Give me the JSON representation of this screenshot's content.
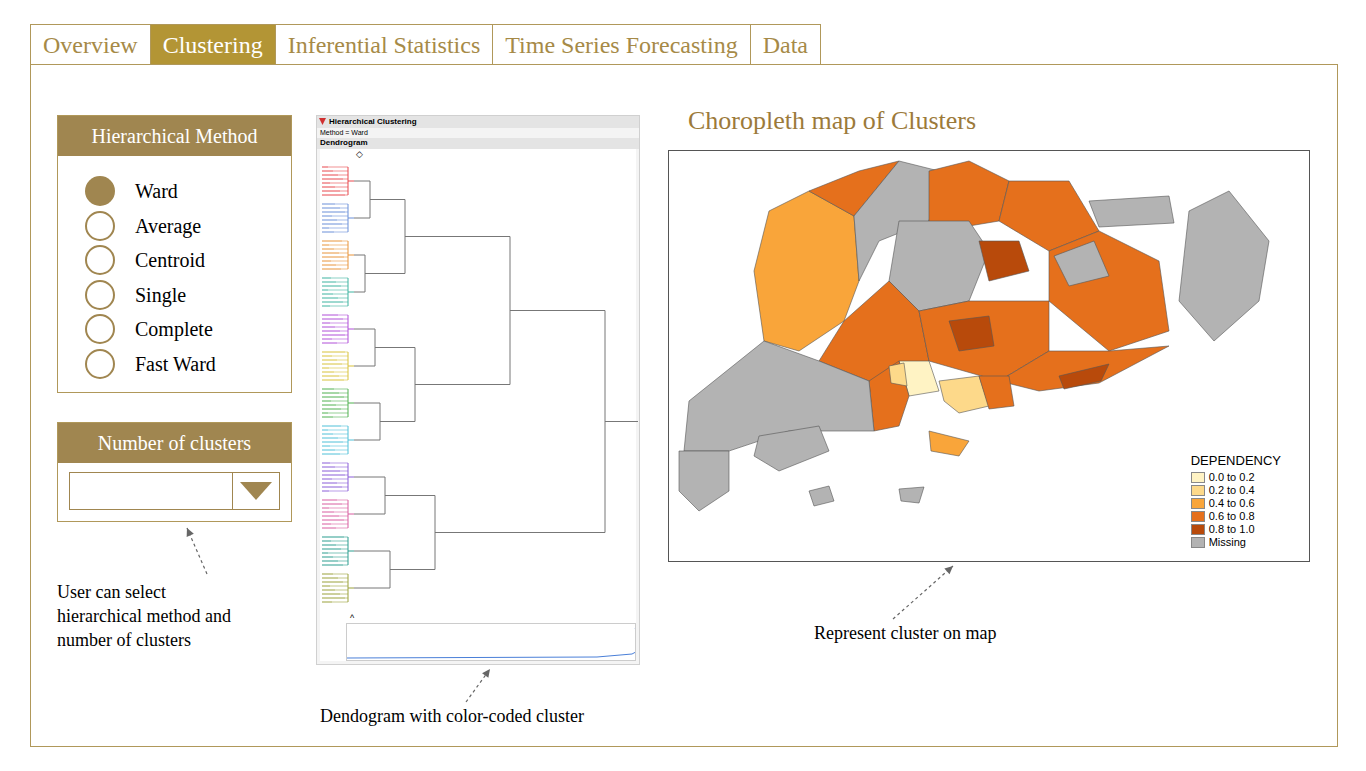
{
  "tabs": [
    {
      "label": "Overview",
      "selected": false
    },
    {
      "label": "Clustering",
      "selected": true
    },
    {
      "label": "Inferential Statistics",
      "selected": false
    },
    {
      "label": "Time Series Forecasting",
      "selected": false
    },
    {
      "label": "Data",
      "selected": false
    }
  ],
  "method_panel": {
    "title": "Hierarchical Method",
    "options": [
      {
        "label": "Ward",
        "selected": true
      },
      {
        "label": "Average",
        "selected": false
      },
      {
        "label": "Centroid",
        "selected": false
      },
      {
        "label": "Single",
        "selected": false
      },
      {
        "label": "Complete",
        "selected": false
      },
      {
        "label": "Fast Ward",
        "selected": false
      }
    ]
  },
  "clusters_panel": {
    "title": "Number of clusters",
    "value": ""
  },
  "notes": {
    "controls": "User can select hierarchical method and number of clusters",
    "dendrogram": "Dendogram with color-coded cluster",
    "map": "Represent cluster on map"
  },
  "dendrogram": {
    "title": "Hierarchical Clustering",
    "method": "Method = Ward",
    "section": "Dendrogram",
    "top_marker": "◇",
    "bottom_marker": "^",
    "cluster_colors": [
      "#e8474c",
      "#6a8fd8",
      "#e8943a",
      "#3cb3a0",
      "#b04fd8",
      "#d8c23a",
      "#4fb04f",
      "#4fc0d8",
      "#8a5cd8",
      "#d85ca0",
      "#2a9d8f",
      "#9aa13a"
    ]
  },
  "map": {
    "title": "Choropleth map of Clusters",
    "legend": {
      "title": "DEPENDENCY",
      "items": [
        {
          "label": "0.0 to 0.2",
          "color": "#fff3c4"
        },
        {
          "label": "0.2 to 0.4",
          "color": "#fdd98a"
        },
        {
          "label": "0.4 to 0.6",
          "color": "#f9a53a"
        },
        {
          "label": "0.6 to 0.8",
          "color": "#e5701c"
        },
        {
          "label": "0.8 to 1.0",
          "color": "#b84a0b"
        },
        {
          "label": "Missing",
          "color": "#b3b3b3"
        }
      ]
    },
    "regions": [
      {
        "class": 2
      },
      {
        "class": 3
      },
      {
        "class": 5
      },
      {
        "class": 3
      },
      {
        "class": 3
      },
      {
        "class": 3
      },
      {
        "class": 5
      },
      {
        "class": 5
      },
      {
        "class": 4
      },
      {
        "class": 3
      },
      {
        "class": 3
      },
      {
        "class": 4
      },
      {
        "class": 3
      },
      {
        "class": 4
      },
      {
        "class": 0
      },
      {
        "class": 1
      },
      {
        "class": 3
      },
      {
        "class": 3
      },
      {
        "class": 5
      },
      {
        "class": 5
      },
      {
        "class": 5
      },
      {
        "class": 2
      },
      {
        "class": 5
      },
      {
        "class": 5
      },
      {
        "class": 5
      },
      {
        "class": 5
      },
      {
        "class": 1
      }
    ]
  }
}
